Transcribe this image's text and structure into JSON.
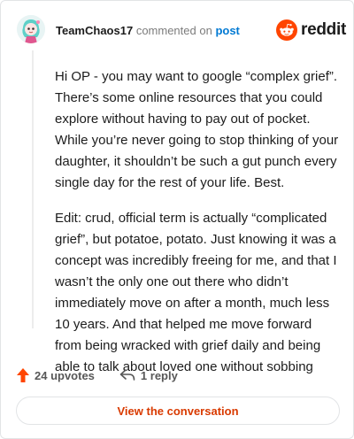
{
  "header": {
    "username": "TeamChaos17",
    "commented_text": "commented on",
    "post_link": "post"
  },
  "brand": {
    "wordmark": "reddit",
    "icon": "reddit-snoo-icon",
    "color": "#ff4500"
  },
  "comment": {
    "paragraphs": [
      "Hi OP - you may want to google “complex grief”. There’s some online resources that you could explore without having to pay out of pocket. While you’re never going to stop thinking of your daughter, it shouldn’t be such a gut punch every single day for the rest of your life. Best.",
      "Edit: crud, official term is actually “complicated grief”, but potatoe, potato. Just knowing it was a concept was incredibly freeing for me, and that I wasn’t the only one out there who didn’t immediately move on after a month, much less 10 years. And that helped me move forward from being wracked with grief daily and being able to talk about loved one without sobbing"
    ]
  },
  "actions": {
    "upvotes": "24 upvotes",
    "replies": "1 reply",
    "upvote_icon": "upvote-arrow-icon",
    "reply_icon": "reply-arrow-icon",
    "upvote_color": "#ff4500"
  },
  "view_button": {
    "label": "View the conversation",
    "color": "#d93a00"
  }
}
